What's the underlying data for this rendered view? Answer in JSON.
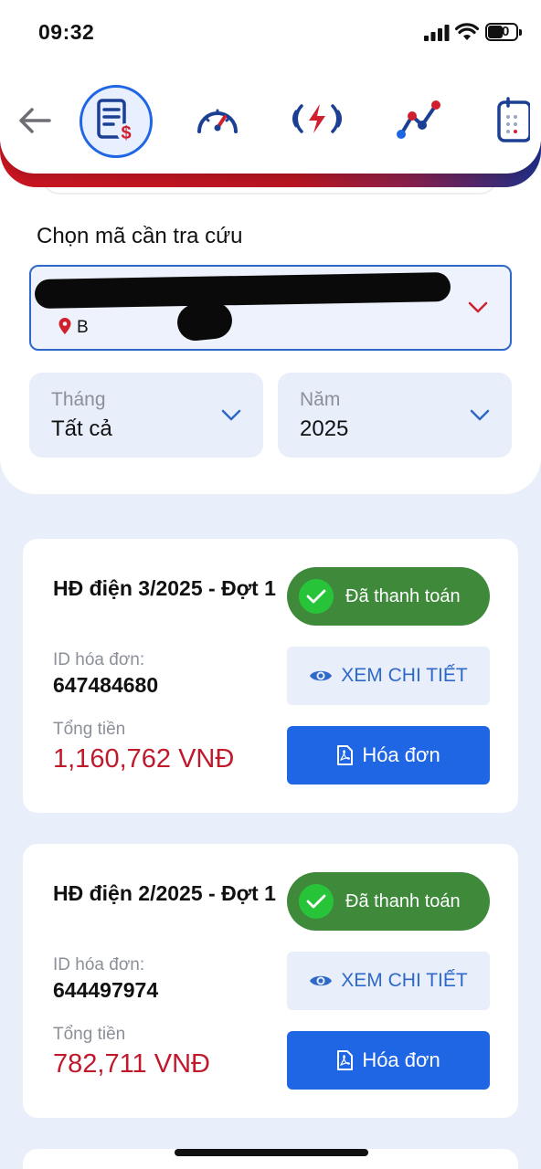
{
  "status_bar": {
    "time": "09:32",
    "battery": "50"
  },
  "nav": {
    "icons": [
      "back-arrow-icon",
      "bill-dollar-icon",
      "speedometer-icon",
      "power-lightning-icon",
      "trend-chart-icon",
      "calendar-icon"
    ],
    "active": "bill-dollar-icon",
    "brand_gradient": [
      "#c91622",
      "#1f2f8a"
    ]
  },
  "selector": {
    "title": "Chọn mã cần tra cứu",
    "address_partial": "B",
    "month_label": "Tháng",
    "month_value": "Tất cả",
    "year_label": "Năm",
    "year_value": "2025"
  },
  "bills": [
    {
      "title": "HĐ điện 3/2025 - Đợt 1",
      "status": "Đã thanh toán",
      "id_label": "ID hóa đơn:",
      "id_value": "647484680",
      "total_label": "Tổng tiền",
      "total_value": "1,160,762 VNĐ",
      "detail_button": "XEM CHI TIẾT",
      "invoice_button": "Hóa đơn"
    },
    {
      "title": "HĐ điện 2/2025 - Đợt 1",
      "status": "Đã thanh toán",
      "id_label": "ID hóa đơn:",
      "id_value": "644497974",
      "total_label": "Tổng tiền",
      "total_value": "782,711 VNĐ",
      "detail_button": "XEM CHI TIẾT",
      "invoice_button": "Hóa đơn"
    }
  ],
  "colors": {
    "accent_blue": "#1f66e5",
    "paid_green": "#3e8a3a",
    "amount_red": "#c0192c"
  }
}
